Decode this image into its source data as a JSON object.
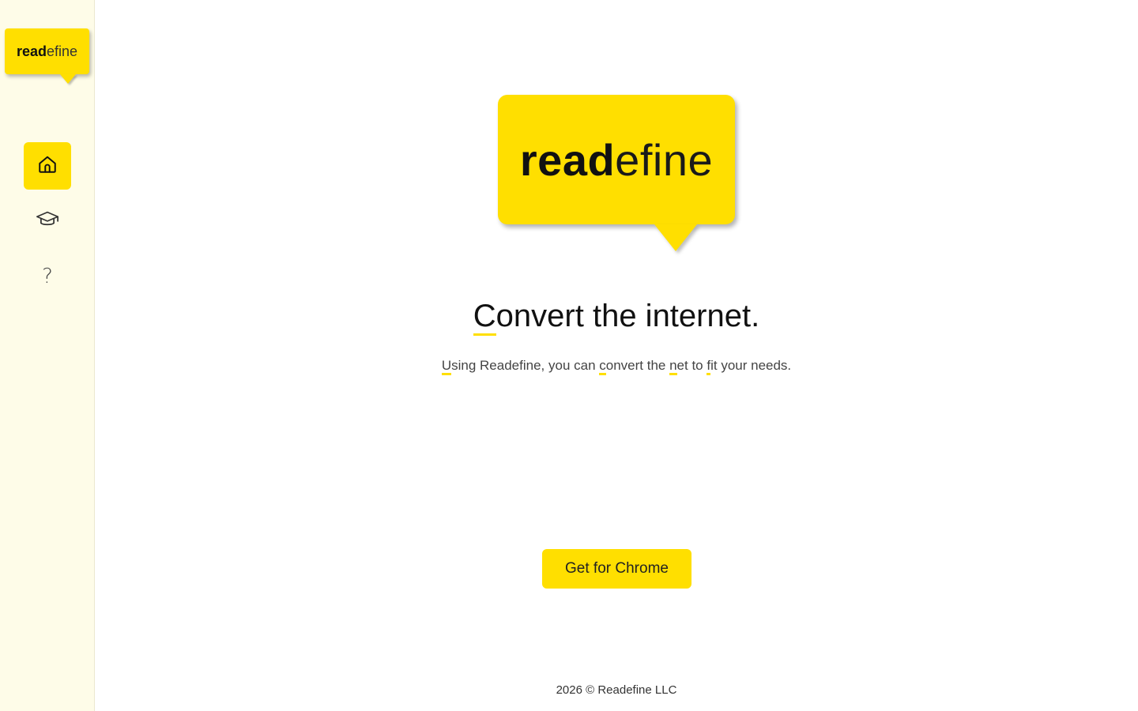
{
  "brand": {
    "logo_bold": "read",
    "logo_light": "efine"
  },
  "sidebar": {
    "items": [
      {
        "name": "home",
        "icon": "home-icon",
        "active": true
      },
      {
        "name": "learn",
        "icon": "graduation-cap-icon",
        "active": false
      },
      {
        "name": "help",
        "icon": "question-mark-icon",
        "glyph": "?",
        "active": false
      }
    ]
  },
  "hero": {
    "headline_first": "C",
    "headline_rest": "onvert the internet.",
    "subline_parts": [
      "U",
      "sing Readefine, you can ",
      "c",
      "onvert the ",
      "n",
      "et to ",
      "f",
      "it your needs."
    ]
  },
  "cta": {
    "label": "Get for Chrome"
  },
  "footer": {
    "text": "2026 © Readefine LLC"
  },
  "colors": {
    "accent": "#ffdf00",
    "sidebar_bg": "#fefce8"
  }
}
